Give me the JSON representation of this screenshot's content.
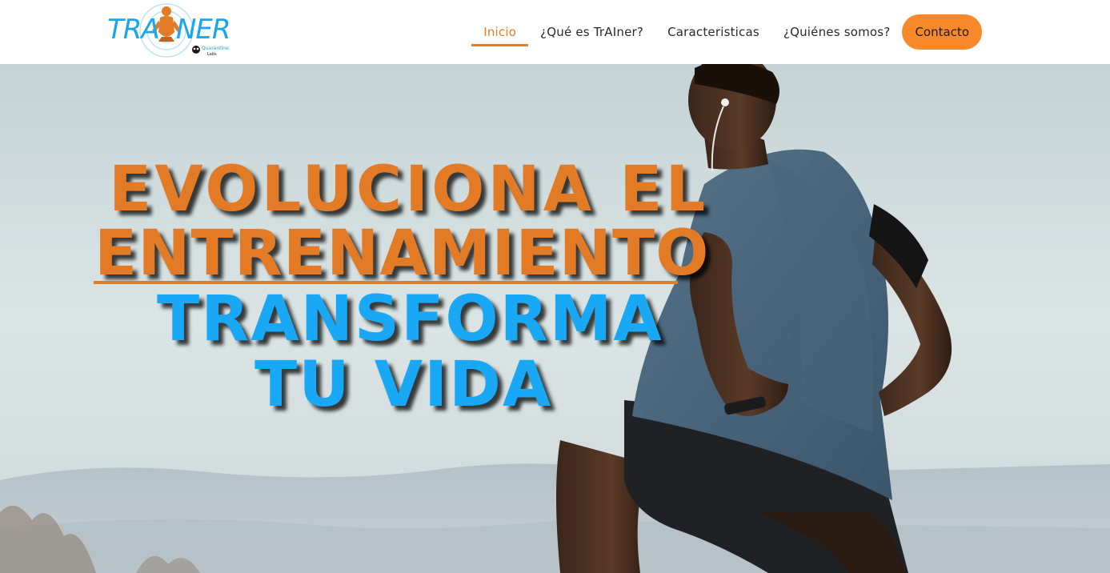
{
  "brand": {
    "logo_text": "TRAINER",
    "logo_sub": "Quarantine Labs"
  },
  "nav": {
    "items": [
      {
        "label": "Inicio",
        "active": true
      },
      {
        "label": "¿Qué es TrAIner?",
        "active": false
      },
      {
        "label": "Caracteristicas",
        "active": false
      },
      {
        "label": "¿Quiénes somos?",
        "active": false
      }
    ],
    "cta_label": "Contacto"
  },
  "hero": {
    "line1": "EVOLUCIONA EL",
    "line2": "ENTRENAMIENTO",
    "line3": "TRANSFORMA",
    "line4": "TU VIDA",
    "image_subject": "runner-athlete-photo"
  },
  "colors": {
    "accent_orange": "#e37a26",
    "accent_blue": "#19a8f5",
    "cta_background": "#f7892a"
  }
}
